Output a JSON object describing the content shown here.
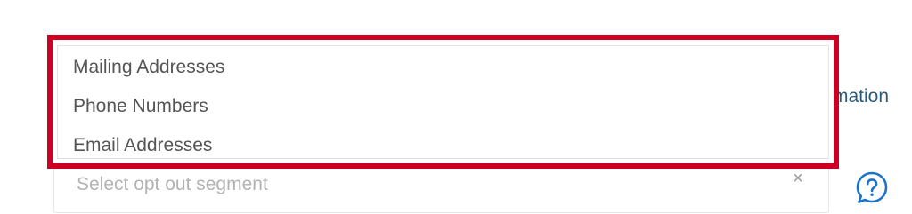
{
  "background_link": {
    "text": "rmation"
  },
  "segment_select": {
    "placeholder": "Select opt out segment",
    "clear_symbol": "×",
    "options": [
      {
        "label": "Mailing Addresses"
      },
      {
        "label": "Phone Numbers"
      },
      {
        "label": "Email Addresses"
      }
    ]
  },
  "help": {
    "icon": "question-circle-icon",
    "color": "#1a73c8"
  },
  "highlight": {
    "color": "#cc0022"
  }
}
